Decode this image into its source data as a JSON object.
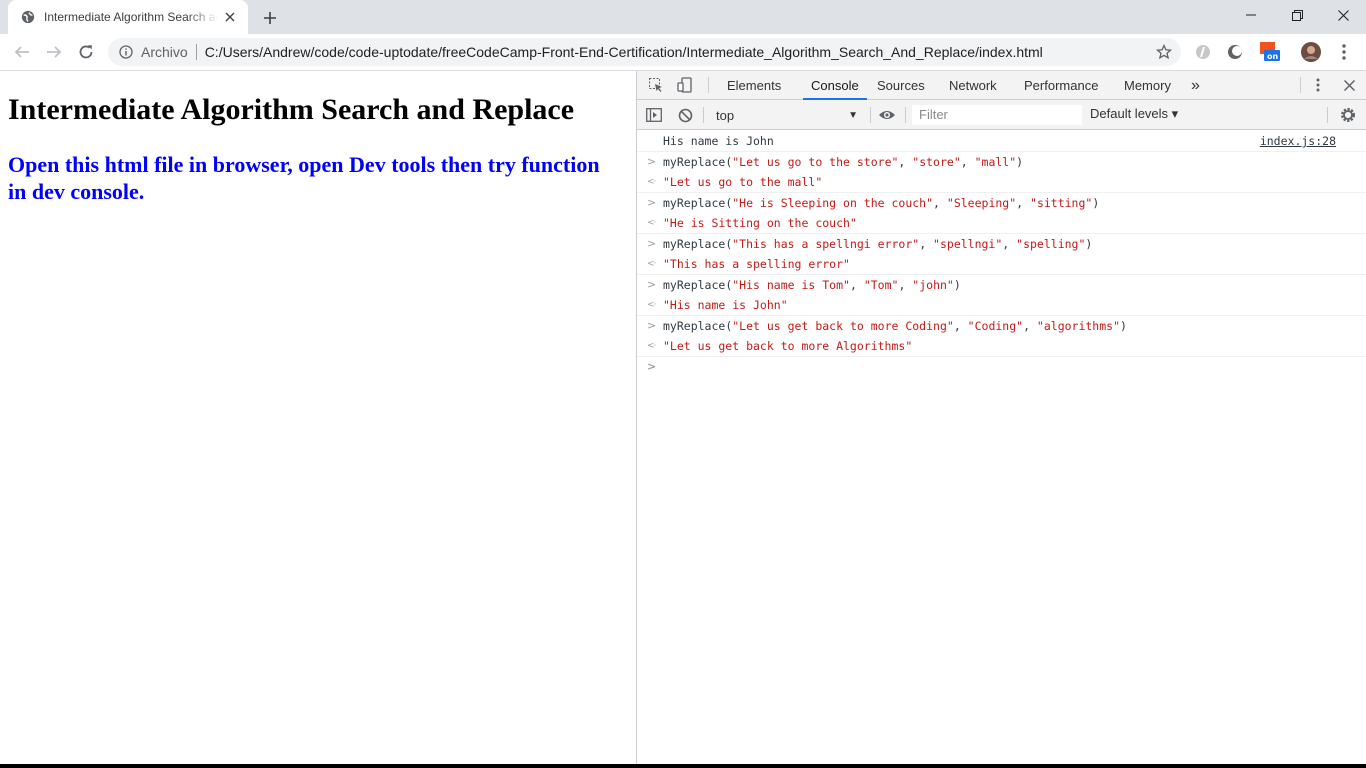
{
  "tab": {
    "title": "Intermediate Algorithm Search and Replace"
  },
  "address_bar": {
    "scheme_label": "Archivo",
    "url": "C:/Users/Andrew/code/code-uptodate/freeCodeCamp-Front-End-Certification/Intermediate_Algorithm_Search_And_Replace/index.html"
  },
  "page": {
    "heading": "Intermediate Algorithm Search and Replace",
    "subheading": "Open this html file in browser, open Dev tools then try function in dev console."
  },
  "devtools": {
    "tabs": [
      "Elements",
      "Console",
      "Sources",
      "Network",
      "Performance",
      "Memory"
    ],
    "active_tab": "Console",
    "more_tabs_label": "»",
    "context": "top",
    "filter_placeholder": "Filter",
    "levels": "Default levels ▾",
    "log": {
      "text": "His name is John",
      "source": "index.js:28"
    },
    "entries": [
      {
        "fn": "myReplace",
        "args": [
          "\"Let us go to the store\"",
          "\"store\"",
          "\"mall\""
        ],
        "result": "\"Let us go to the mall\""
      },
      {
        "fn": "myReplace",
        "args": [
          "\"He is Sleeping on the couch\"",
          "\"Sleeping\"",
          "\"sitting\""
        ],
        "result": "\"He is Sitting on the couch\""
      },
      {
        "fn": "myReplace",
        "args": [
          "\"This has a spellngi error\"",
          "\"spellngi\"",
          "\"spelling\""
        ],
        "result": "\"This has a spelling error\""
      },
      {
        "fn": "myReplace",
        "args": [
          "\"His name is Tom\"",
          "\"Tom\"",
          "\"john\""
        ],
        "result": "\"His name is John\""
      },
      {
        "fn": "myReplace",
        "args": [
          "\"Let us get back to more Coding\"",
          "\"Coding\"",
          "\"algorithms\""
        ],
        "result": "\"Let us get back to more Algorithms\""
      }
    ]
  },
  "colors": {
    "accent": "#1a73e8",
    "console_string": "#c41a16",
    "heading_blue": "#0000ff"
  }
}
